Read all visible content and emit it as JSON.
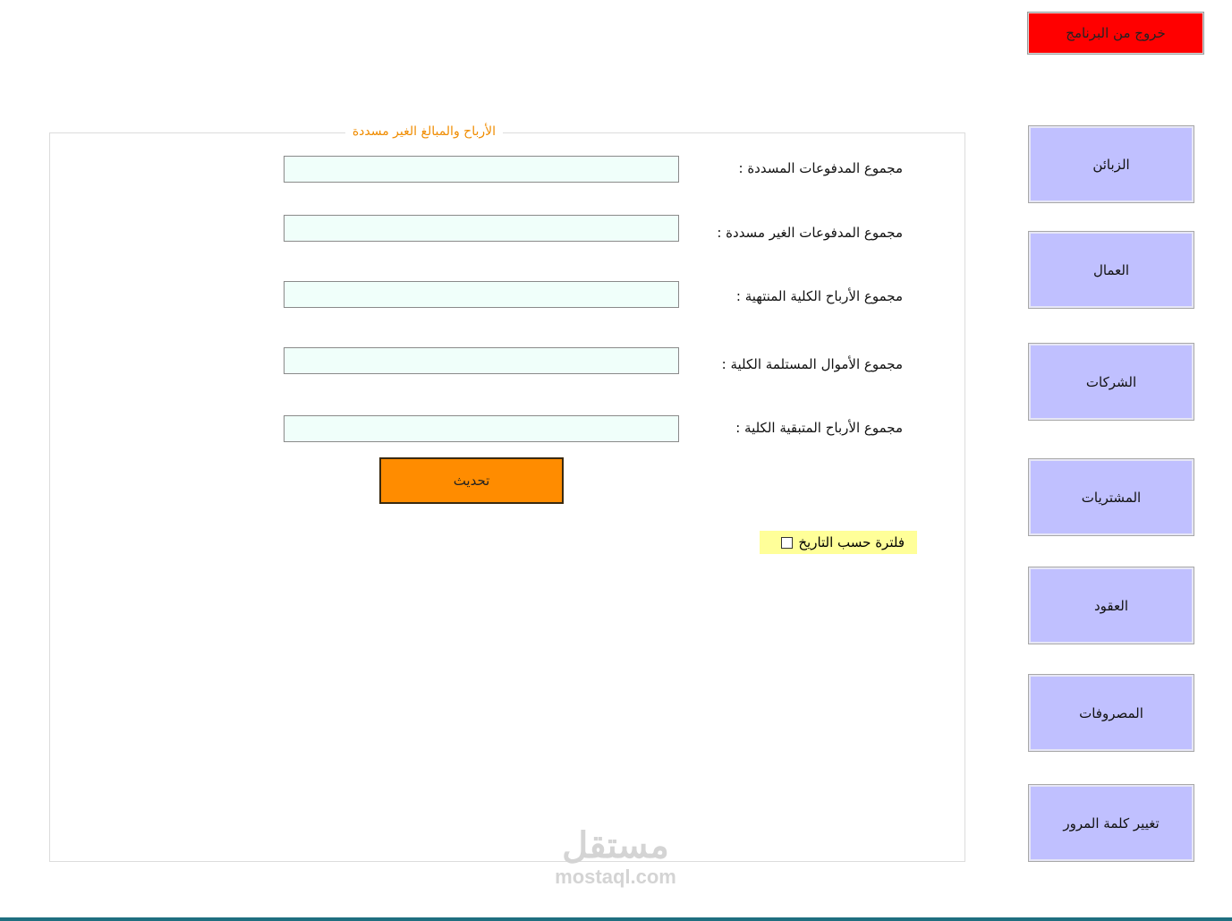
{
  "exit_button": {
    "label": "خروج من البرنامج",
    "color": "#ff0000"
  },
  "nav": {
    "color": "#c0c0ff",
    "items": [
      {
        "label": "الزبائن"
      },
      {
        "label": "العمال"
      },
      {
        "label": "الشركات"
      },
      {
        "label": "المشتريات"
      },
      {
        "label": "العقود"
      },
      {
        "label": "المصروفات"
      },
      {
        "label": "تغيير كلمة المرور"
      }
    ]
  },
  "group": {
    "title": "الأرباح والمبالغ الغير مسددة",
    "title_color": "#f08c00",
    "fields": [
      {
        "label": "مجموع المدفوعات المسددة :",
        "value": ""
      },
      {
        "label": "مجموع المدفوعات الغير مسددة :",
        "value": ""
      },
      {
        "label": "مجموع الأرباح الكلية المنتهية  :",
        "value": ""
      },
      {
        "label": "مجموع الأموال المستلمة الكلية :",
        "value": ""
      },
      {
        "label": "مجموع الأرباح المتبقية الكلية :",
        "value": ""
      }
    ],
    "update_button": {
      "label": "تحديث",
      "color": "#ff8c00"
    },
    "filter": {
      "label": "فلترة حسب التاريخ",
      "checked": false,
      "highlight": "#ffff99"
    }
  },
  "watermark": {
    "arabic": "مستقل",
    "latin": "mostaql.com"
  }
}
